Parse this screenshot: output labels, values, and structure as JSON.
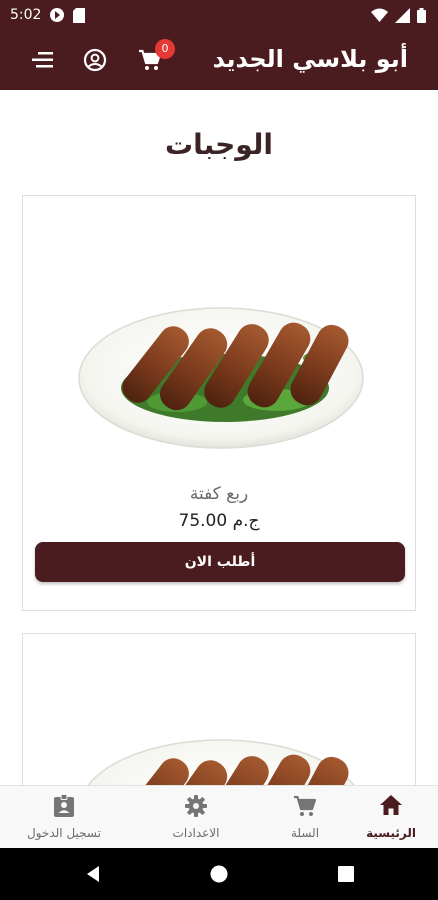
{
  "status_bar": {
    "time": "5:02",
    "icons": [
      "media-icon",
      "sd-card-icon",
      "wifi-icon",
      "signal-icon",
      "battery-icon"
    ]
  },
  "app_bar": {
    "title": "أبو بلاسي الجديد",
    "cart_count": "0",
    "icons": [
      "menu-icon",
      "account-icon",
      "cart-icon"
    ]
  },
  "main": {
    "section_title": "الوجبات",
    "products": [
      {
        "name": "ربع كفتة",
        "price": "ج.م 75.00",
        "button_label": "أطلب الان",
        "image": "kofta-plate"
      },
      {
        "image": "kofta-plate"
      }
    ]
  },
  "bottom_nav": {
    "items": [
      {
        "label": "الرئيسية",
        "icon": "home-icon",
        "active": true
      },
      {
        "label": "السلة",
        "icon": "cart-icon",
        "active": false
      },
      {
        "label": "الاعدادات",
        "icon": "gear-icon",
        "active": false
      },
      {
        "label": "تسجيل الدخول",
        "icon": "login-badge-icon",
        "active": false
      }
    ]
  },
  "colors": {
    "primary": "#4a1c1f",
    "badge": "#e53935",
    "background": "#ffffff"
  }
}
